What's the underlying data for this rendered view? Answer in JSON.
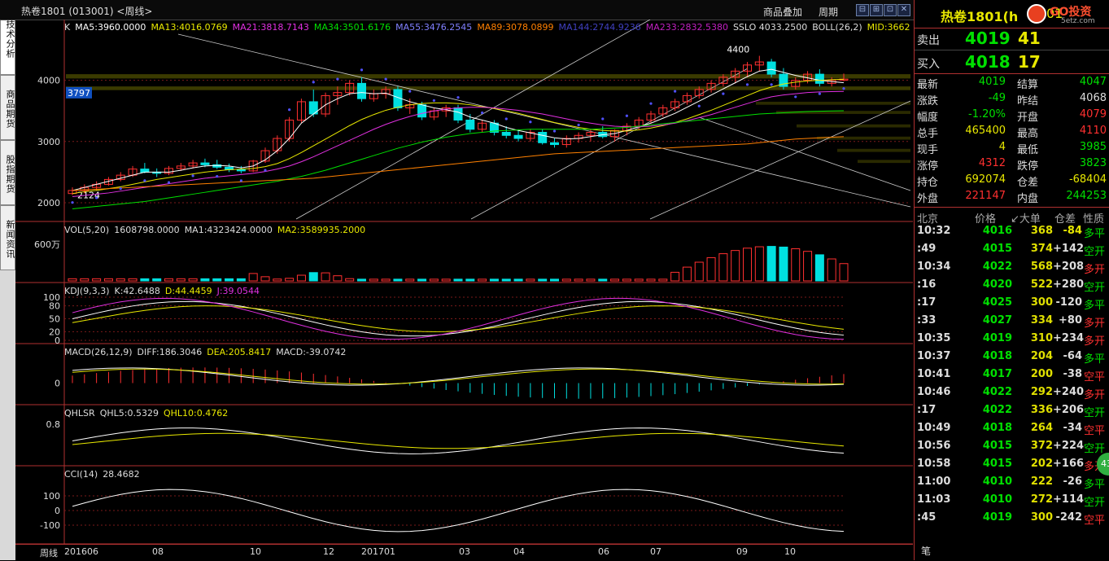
{
  "window": {
    "title": "热卷1801 (013001) <周线>",
    "links": [
      "商品叠加",
      "周期"
    ],
    "buttons": [
      "⊟",
      "⊞",
      "⊡",
      "✕"
    ]
  },
  "left_tabs": [
    {
      "label": "技术分析",
      "active": true
    },
    {
      "label": "商品期货",
      "active": false
    },
    {
      "label": "股指期货",
      "active": false
    },
    {
      "label": "新闻资讯",
      "active": false
    }
  ],
  "colors": {
    "ma5": "#ffffff",
    "ma13": "#e8e800",
    "ma21": "#e030e0",
    "ma34": "#00e000",
    "ma55": "#6060ff",
    "ma89": "#ff8000",
    "ma144": "#4040c0",
    "ma233": "#c020c0",
    "up": "#ff3030",
    "down": "#00e0e0",
    "accent": "#e8e800",
    "sar": "#5050ff"
  },
  "main_legend": {
    "k": "K",
    "ma5": "MA5:3960.0000",
    "ma13": "MA13:4016.0769",
    "ma21": "MA21:3818.7143",
    "ma34": "MA34:3501.6176",
    "ma55": "MA55:3476.2545",
    "ma89": "MA89:3078.0899",
    "ma144": "MA144:2744.9236",
    "ma233": "MA233:2832.5380",
    "sslo": "SSLO  4033.2500",
    "boll": "BOLL(26,2)",
    "mid": "MID:3662"
  },
  "main_axis": {
    "ticks": [
      "4000",
      "3000",
      "2000"
    ],
    "price_tag": "3797",
    "high_label": "4400",
    "low_label": "2124"
  },
  "vol_legend": {
    "name": "VOL(5,20)",
    "v": "1608798.0000",
    "ma1": "MA1:4323424.0000",
    "ma2": "MA2:3589935.2000",
    "tick": "600万"
  },
  "kdj_legend": {
    "name": "KDJ(9,3,3)",
    "k": "K:42.6488",
    "d": "D:44.4459",
    "j": "J:39.0544",
    "ticks": [
      "100",
      "80",
      "50",
      "20",
      "0"
    ]
  },
  "macd_legend": {
    "name": "MACD(26,12,9)",
    "diff": "DIFF:186.3046",
    "dea": "DEA:205.8417",
    "macd": "MACD:-39.0742",
    "tick": "0"
  },
  "qhlsr_legend": {
    "name": "QHLSR",
    "qhl5": "QHL5:0.5329",
    "qhl10": "QHL10:0.4762",
    "tick": "0.8"
  },
  "cci_legend": {
    "name": "CCI(14)",
    "value": "28.4682",
    "ticks": [
      "100",
      "0",
      "-100"
    ]
  },
  "time_axis": {
    "label": "周线",
    "ticks": [
      "201606",
      "08",
      "10",
      "12",
      "201701",
      "03",
      "04",
      "06",
      "07",
      "09",
      "10"
    ]
  },
  "quote_header": {
    "title": "热卷1801(h",
    "suffix": "01",
    "brand": "GO投资",
    "site": "5etz.com"
  },
  "quotes": {
    "sell": {
      "label": "卖出",
      "price": "4019",
      "vol": "41"
    },
    "buy": {
      "label": "买入",
      "price": "4018",
      "vol": "17"
    },
    "rows": [
      {
        "l1": "最新",
        "v1": "4019",
        "c1": "green",
        "l2": "结算",
        "v2": "4047",
        "c2": "green"
      },
      {
        "l1": "涨跌",
        "v1": "-49",
        "c1": "green",
        "l2": "昨结",
        "v2": "4068",
        "c2": "wht"
      },
      {
        "l1": "幅度",
        "v1": "-1.20%",
        "c1": "green",
        "l2": "开盘",
        "v2": "4079",
        "c2": "red"
      },
      {
        "l1": "总手",
        "v1": "465400",
        "c1": "yel",
        "l2": "最高",
        "v2": "4110",
        "c2": "red"
      },
      {
        "l1": "现手",
        "v1": "4",
        "c1": "yel",
        "l2": "最低",
        "v2": "3985",
        "c2": "green"
      },
      {
        "l1": "涨停",
        "v1": "4312",
        "c1": "red",
        "l2": "跌停",
        "v2": "3823",
        "c2": "green"
      },
      {
        "l1": "持仓",
        "v1": "692074",
        "c1": "yel",
        "l2": "仓差",
        "v2": "-68404",
        "c2": "yel"
      },
      {
        "l1": "外盘",
        "v1": "221147",
        "c1": "red",
        "l2": "内盘",
        "v2": "244253",
        "c2": "green"
      }
    ]
  },
  "trades_header": {
    "time": "北京",
    "price": "价格",
    "vol": "↙大单",
    "oi": "仓差",
    "nature": "性质"
  },
  "trades": [
    {
      "time": "10:32",
      "price": "4016",
      "vol": "368",
      "oi": "-84",
      "oic": "yel",
      "nature": "多平",
      "nc": "green"
    },
    {
      "time": ":49",
      "price": "4015",
      "vol": "374",
      "oi": "+142",
      "oic": "wht",
      "nature": "空开",
      "nc": "green"
    },
    {
      "time": "10:34",
      "price": "4022",
      "vol": "568",
      "oi": "+208",
      "oic": "wht",
      "nature": "多开",
      "nc": "red"
    },
    {
      "time": ":16",
      "price": "4020",
      "vol": "522",
      "oi": "+280",
      "oic": "wht",
      "nature": "空开",
      "nc": "green"
    },
    {
      "time": ":17",
      "price": "4025",
      "vol": "300",
      "oi": "-120",
      "oic": "wht",
      "nature": "多平",
      "nc": "green"
    },
    {
      "time": ":33",
      "price": "4027",
      "vol": "334",
      "oi": "+80",
      "oic": "wht",
      "nature": "多开",
      "nc": "red"
    },
    {
      "time": "10:35",
      "price": "4019",
      "vol": "310",
      "oi": "+234",
      "oic": "wht",
      "nature": "多开",
      "nc": "red"
    },
    {
      "time": "10:37",
      "price": "4018",
      "vol": "204",
      "oi": "-64",
      "oic": "wht",
      "nature": "多平",
      "nc": "green"
    },
    {
      "time": "10:41",
      "price": "4017",
      "vol": "200",
      "oi": "-38",
      "oic": "wht",
      "nature": "空平",
      "nc": "red"
    },
    {
      "time": "10:46",
      "price": "4022",
      "vol": "292",
      "oi": "+240",
      "oic": "wht",
      "nature": "多开",
      "nc": "red"
    },
    {
      "time": ":17",
      "price": "4022",
      "vol": "336",
      "oi": "+206",
      "oic": "wht",
      "nature": "空开",
      "nc": "green"
    },
    {
      "time": "10:49",
      "price": "4018",
      "vol": "264",
      "oi": "-34",
      "oic": "wht",
      "nature": "空平",
      "nc": "red"
    },
    {
      "time": "10:56",
      "price": "4015",
      "vol": "372",
      "oi": "+224",
      "oic": "wht",
      "nature": "空开",
      "nc": "green"
    },
    {
      "time": "10:58",
      "price": "4015",
      "vol": "202",
      "oi": "+166",
      "oic": "wht",
      "nature": "多开",
      "nc": "red"
    },
    {
      "time": "11:00",
      "price": "4010",
      "vol": "222",
      "oi": "-26",
      "oic": "wht",
      "nature": "多平",
      "nc": "green"
    },
    {
      "time": "11:03",
      "price": "4010",
      "vol": "272",
      "oi": "+114",
      "oic": "wht",
      "nature": "空开",
      "nc": "green"
    },
    {
      "time": ":45",
      "price": "4019",
      "vol": "300",
      "oi": "-242",
      "oic": "wht",
      "nature": "空平",
      "nc": "red"
    }
  ],
  "footer_label": "笔",
  "badge": "43",
  "chart_data": {
    "type": "candlestick",
    "title": "热卷1801 (013001) <周线>",
    "ylim": [
      1800,
      4700
    ],
    "yticks": [
      2000,
      3000,
      4000
    ],
    "x_ticks": [
      "201606",
      "08",
      "10",
      "12",
      "201701",
      "03",
      "04",
      "06",
      "07",
      "09",
      "10"
    ],
    "ohlc": [
      [
        2150,
        2250,
        2124,
        2200
      ],
      [
        2200,
        2300,
        2150,
        2250
      ],
      [
        2250,
        2350,
        2200,
        2300
      ],
      [
        2300,
        2420,
        2280,
        2380
      ],
      [
        2380,
        2500,
        2350,
        2450
      ],
      [
        2450,
        2600,
        2420,
        2550
      ],
      [
        2550,
        2650,
        2480,
        2500
      ],
      [
        2500,
        2560,
        2420,
        2480
      ],
      [
        2480,
        2600,
        2450,
        2560
      ],
      [
        2560,
        2650,
        2520,
        2600
      ],
      [
        2600,
        2700,
        2560,
        2650
      ],
      [
        2650,
        2720,
        2580,
        2620
      ],
      [
        2620,
        2700,
        2550,
        2580
      ],
      [
        2580,
        2640,
        2500,
        2540
      ],
      [
        2540,
        2600,
        2480,
        2520
      ],
      [
        2520,
        2700,
        2500,
        2680
      ],
      [
        2680,
        2900,
        2650,
        2850
      ],
      [
        2850,
        3100,
        2800,
        3050
      ],
      [
        3050,
        3400,
        3000,
        3350
      ],
      [
        3350,
        3700,
        3300,
        3650
      ],
      [
        3650,
        3850,
        3400,
        3450
      ],
      [
        3450,
        3800,
        3400,
        3750
      ],
      [
        3750,
        3900,
        3600,
        3800
      ],
      [
        3800,
        4000,
        3750,
        3950
      ],
      [
        3950,
        4050,
        3650,
        3700
      ],
      [
        3700,
        3850,
        3650,
        3780
      ],
      [
        3780,
        3900,
        3700,
        3850
      ],
      [
        3850,
        3900,
        3500,
        3550
      ],
      [
        3550,
        3700,
        3450,
        3600
      ],
      [
        3600,
        3650,
        3350,
        3400
      ],
      [
        3400,
        3550,
        3350,
        3500
      ],
      [
        3500,
        3600,
        3400,
        3550
      ],
      [
        3550,
        3600,
        3300,
        3350
      ],
      [
        3350,
        3450,
        3150,
        3200
      ],
      [
        3200,
        3350,
        3150,
        3300
      ],
      [
        3300,
        3350,
        3100,
        3150
      ],
      [
        3150,
        3250,
        3050,
        3100
      ],
      [
        3100,
        3200,
        3000,
        3050
      ],
      [
        3050,
        3200,
        3000,
        3150
      ],
      [
        3150,
        3200,
        2950,
        2980
      ],
      [
        2980,
        3050,
        2900,
        2950
      ],
      [
        2950,
        3100,
        2900,
        3050
      ],
      [
        3050,
        3150,
        2980,
        3100
      ],
      [
        3100,
        3200,
        3000,
        3150
      ],
      [
        3150,
        3250,
        3050,
        3080
      ],
      [
        3080,
        3200,
        3000,
        3180
      ],
      [
        3180,
        3300,
        3100,
        3250
      ],
      [
        3250,
        3400,
        3200,
        3350
      ],
      [
        3350,
        3500,
        3300,
        3450
      ],
      [
        3450,
        3600,
        3400,
        3550
      ],
      [
        3550,
        3700,
        3500,
        3650
      ],
      [
        3650,
        3800,
        3600,
        3750
      ],
      [
        3750,
        3900,
        3700,
        3850
      ],
      [
        3850,
        4000,
        3800,
        3950
      ],
      [
        3950,
        4100,
        3900,
        4050
      ],
      [
        4050,
        4200,
        3950,
        4150
      ],
      [
        4150,
        4300,
        4050,
        4250
      ],
      [
        4250,
        4400,
        4150,
        4300
      ],
      [
        4300,
        4350,
        4050,
        4100
      ],
      [
        4100,
        4200,
        3850,
        3900
      ],
      [
        3900,
        4050,
        3850,
        4000
      ],
      [
        4000,
        4150,
        3950,
        4100
      ],
      [
        4100,
        4180,
        3900,
        3950
      ],
      [
        3950,
        4050,
        3900,
        4000
      ],
      [
        4000,
        4110,
        3985,
        4019
      ]
    ],
    "series": [
      {
        "name": "MA5",
        "values": [
          2200,
          2250,
          2300,
          2350,
          2400,
          2450,
          2500,
          2500,
          2500,
          2530,
          2570,
          2600,
          2610,
          2600,
          2570,
          2600,
          2700,
          2850,
          3050,
          3300,
          3450,
          3600,
          3700,
          3780,
          3800,
          3780,
          3790,
          3720,
          3650,
          3600,
          3550,
          3520,
          3480,
          3400,
          3350,
          3300,
          3230,
          3180,
          3140,
          3100,
          3060,
          3040,
          3050,
          3080,
          3110,
          3130,
          3180,
          3240,
          3300,
          3380,
          3460,
          3560,
          3660,
          3760,
          3860,
          3960,
          4060,
          4150,
          4180,
          4130,
          4080,
          4040,
          4000,
          3980,
          3960
        ]
      },
      {
        "name": "MA13",
        "values": [
          2150,
          2180,
          2200,
          2230,
          2260,
          2300,
          2340,
          2380,
          2410,
          2440,
          2470,
          2500,
          2520,
          2540,
          2550,
          2560,
          2590,
          2640,
          2720,
          2820,
          2930,
          3040,
          3150,
          3260,
          3360,
          3440,
          3510,
          3560,
          3600,
          3620,
          3630,
          3630,
          3620,
          3600,
          3570,
          3540,
          3500,
          3460,
          3410,
          3360,
          3310,
          3270,
          3230,
          3200,
          3180,
          3170,
          3170,
          3190,
          3220,
          3260,
          3310,
          3370,
          3440,
          3510,
          3590,
          3670,
          3750,
          3830,
          3890,
          3940,
          3970,
          3990,
          4000,
          4010,
          4016
        ]
      },
      {
        "name": "MA21",
        "values": [
          2100,
          2120,
          2140,
          2160,
          2190,
          2220,
          2250,
          2280,
          2310,
          2340,
          2370,
          2400,
          2420,
          2440,
          2460,
          2480,
          2510,
          2550,
          2600,
          2670,
          2750,
          2840,
          2930,
          3020,
          3110,
          3200,
          3280,
          3350,
          3410,
          3460,
          3500,
          3530,
          3550,
          3560,
          3560,
          3550,
          3530,
          3510,
          3480,
          3450,
          3410,
          3370,
          3330,
          3300,
          3270,
          3250,
          3240,
          3240,
          3250,
          3270,
          3300,
          3340,
          3390,
          3440,
          3500,
          3560,
          3620,
          3680,
          3730,
          3760,
          3780,
          3800,
          3810,
          3815,
          3819
        ]
      },
      {
        "name": "MA34",
        "values": [
          1900,
          1920,
          1940,
          1960,
          1980,
          2000,
          2020,
          2050,
          2080,
          2110,
          2140,
          2170,
          2200,
          2230,
          2260,
          2290,
          2320,
          2350,
          2390,
          2430,
          2480,
          2530,
          2590,
          2650,
          2710,
          2770,
          2830,
          2890,
          2940,
          2990,
          3030,
          3070,
          3100,
          3130,
          3150,
          3170,
          3180,
          3190,
          3200,
          3200,
          3200,
          3200,
          3200,
          3200,
          3210,
          3220,
          3230,
          3250,
          3270,
          3290,
          3310,
          3330,
          3350,
          3370,
          3390,
          3410,
          3430,
          3450,
          3460,
          3470,
          3480,
          3490,
          3495,
          3500,
          3502
        ]
      },
      {
        "name": "MA89",
        "values": [
          2200,
          2210,
          2220,
          2230,
          2240,
          2250,
          2260,
          2270,
          2280,
          2290,
          2300,
          2310,
          2320,
          2330,
          2340,
          2350,
          2360,
          2370,
          2380,
          2390,
          2400,
          2420,
          2440,
          2460,
          2480,
          2500,
          2520,
          2540,
          2560,
          2580,
          2600,
          2620,
          2640,
          2660,
          2680,
          2700,
          2720,
          2740,
          2760,
          2780,
          2800,
          2810,
          2820,
          2830,
          2840,
          2850,
          2860,
          2870,
          2880,
          2890,
          2900,
          2910,
          2920,
          2930,
          2940,
          2950,
          2960,
          2980,
          3000,
          3020,
          3040,
          3050,
          3060,
          3070,
          3078
        ]
      }
    ]
  }
}
